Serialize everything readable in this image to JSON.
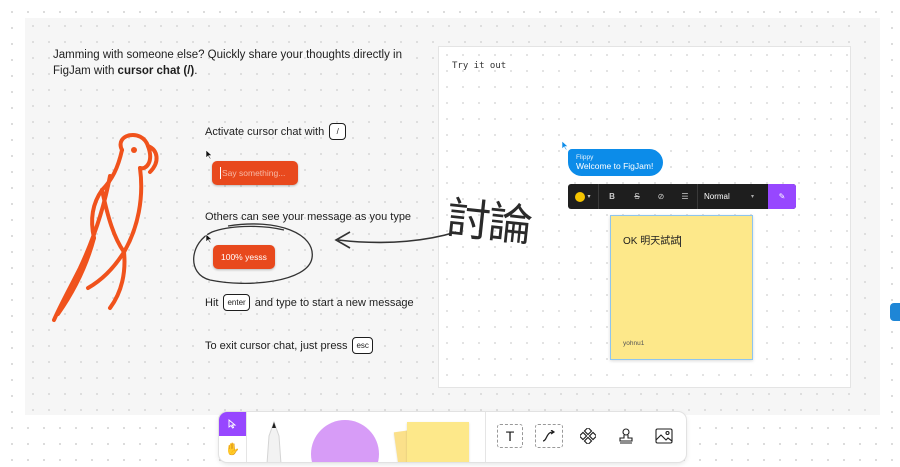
{
  "intro": {
    "line1": "Jamming with someone else? Quickly share your thoughts directly in",
    "line2_prefix": "FigJam with ",
    "line2_bold": "cursor chat (/)",
    "line2_suffix": "."
  },
  "steps": {
    "activate": {
      "text": "Activate cursor chat with",
      "key": "/"
    },
    "input_placeholder": "Say something...",
    "others": "Others can see your message as you type",
    "message": "100% yesss",
    "hit_prefix": "Hit",
    "hit_key": "enter",
    "hit_suffix": "and type to start a new message",
    "exit_text": "To exit cursor chat, just press",
    "exit_key": "esc"
  },
  "annotation": "討論",
  "panel": {
    "try_label": "Try it out",
    "cursor_chat": {
      "name": "Flippy",
      "message": "Welcome to FigJam!"
    },
    "format_toolbar": {
      "style": "Normal",
      "swatch_color": "#f5c400",
      "accent": "#9747ff"
    },
    "sticky": {
      "text": "OK 明天試試",
      "author": "yohnu1",
      "color": "#fde88a"
    }
  },
  "colors": {
    "accent_orange": "#e8491d",
    "figma_blue": "#0c8ce9",
    "tool_purple": "#9747ff"
  },
  "dock": {
    "tools": [
      "select-pointer",
      "hand",
      "marker",
      "shape",
      "sticky",
      "text",
      "connector",
      "components",
      "stamp",
      "image"
    ]
  }
}
